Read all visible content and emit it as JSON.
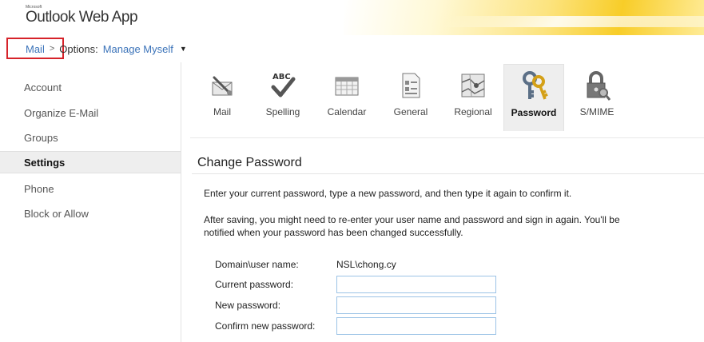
{
  "app": {
    "brand_small": "Microsoft",
    "brand": "Outlook Web App"
  },
  "breadcrumb": {
    "mail": "Mail",
    "arrow": ">",
    "options": "Options:",
    "manage": "Manage Myself",
    "caret": "▼"
  },
  "sidebar": {
    "items": [
      {
        "label": "Account"
      },
      {
        "label": "Organize E-Mail"
      },
      {
        "label": "Groups"
      },
      {
        "label": "Settings"
      },
      {
        "label": "Phone"
      },
      {
        "label": "Block or Allow"
      }
    ]
  },
  "toolbar": {
    "items": [
      {
        "label": "Mail",
        "icon": "mail-settings-icon"
      },
      {
        "label": "Spelling",
        "icon": "spelling-icon"
      },
      {
        "label": "Calendar",
        "icon": "calendar-icon"
      },
      {
        "label": "General",
        "icon": "general-icon"
      },
      {
        "label": "Regional",
        "icon": "regional-icon"
      },
      {
        "label": "Password",
        "icon": "keys-icon"
      },
      {
        "label": "S/MIME",
        "icon": "lock-icon"
      }
    ],
    "active": "Password"
  },
  "main": {
    "title": "Change Password",
    "intro": "Enter your current password, type a new password, and then type it again to confirm it.",
    "note_line1": "After saving, you might need to re-enter your user name and password and sign in again. You'll be",
    "note_line2": "notified when your password has been changed successfully.",
    "form": {
      "domain_label": "Domain\\user name:",
      "domain_value": "NSL\\chong.cy",
      "current_label": "Current password:",
      "new_label": "New password:",
      "confirm_label": "Confirm new password:"
    }
  },
  "colors": {
    "link": "#3b73b9",
    "highlight_box": "#d6232a",
    "input_border": "#9cc3e6",
    "active_bg": "#eeeeee"
  }
}
